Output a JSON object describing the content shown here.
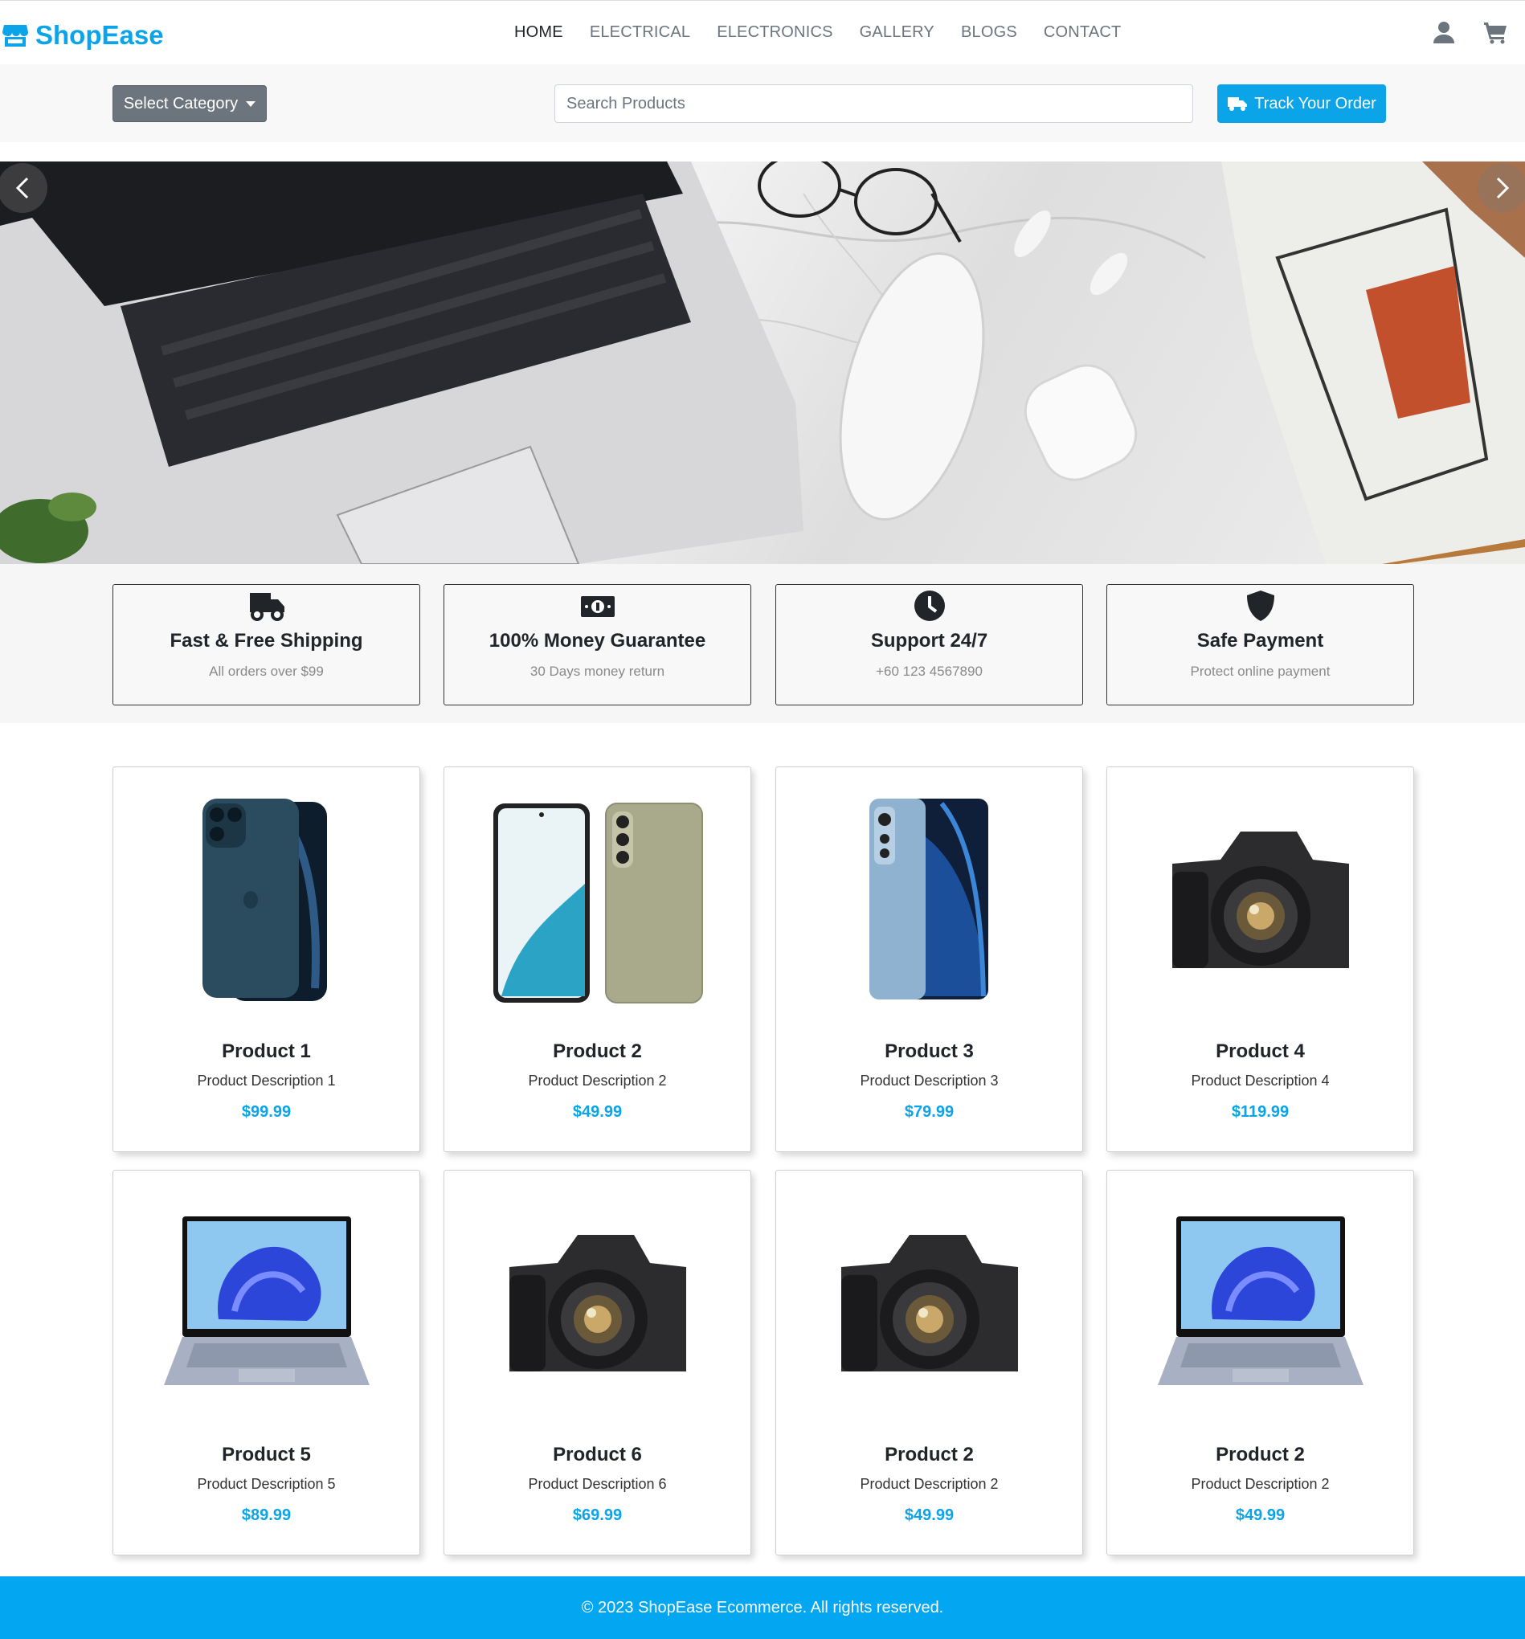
{
  "brand": {
    "name": "ShopEase",
    "color": "#0ba4e8",
    "icon": "store-icon"
  },
  "nav": {
    "links": [
      {
        "label": "HOME",
        "active": true
      },
      {
        "label": "ELECTRICAL",
        "active": false
      },
      {
        "label": "ELECTRONICS",
        "active": false
      },
      {
        "label": "GALLERY",
        "active": false
      },
      {
        "label": "BLOGS",
        "active": false
      },
      {
        "label": "CONTACT",
        "active": false
      }
    ],
    "icons": [
      "user-icon",
      "cart-icon"
    ]
  },
  "search": {
    "category_label": "Select Category",
    "placeholder": "Search Products",
    "track_label": "Track Your Order"
  },
  "hero": {
    "alt": "laptop-desk-scene"
  },
  "features": [
    {
      "icon": "truck-icon",
      "title": "Fast & Free Shipping",
      "subtitle": "All orders over $99"
    },
    {
      "icon": "money-icon",
      "title": "100% Money Guarantee",
      "subtitle": "30 Days money return"
    },
    {
      "icon": "clock-icon",
      "title": "Support 24/7",
      "subtitle": "+60 123 4567890"
    },
    {
      "icon": "shield-icon",
      "title": "Safe Payment",
      "subtitle": "Protect online payment"
    }
  ],
  "products": [
    {
      "title": "Product 1",
      "description": "Product Description 1",
      "price": "$99.99",
      "image": "iphone"
    },
    {
      "title": "Product 2",
      "description": "Product Description 2",
      "price": "$49.99",
      "image": "galaxy"
    },
    {
      "title": "Product 3",
      "description": "Product Description 3",
      "price": "$79.99",
      "image": "xiaomi"
    },
    {
      "title": "Product 4",
      "description": "Product Description 4",
      "price": "$119.99",
      "image": "camera"
    },
    {
      "title": "Product 5",
      "description": "Product Description 5",
      "price": "$89.99",
      "image": "laptop"
    },
    {
      "title": "Product 6",
      "description": "Product Description 6",
      "price": "$69.99",
      "image": "camera"
    },
    {
      "title": "Product 2",
      "description": "Product Description 2",
      "price": "$49.99",
      "image": "camera"
    },
    {
      "title": "Product 2",
      "description": "Product Description 2",
      "price": "$49.99",
      "image": "laptop"
    }
  ],
  "footer": {
    "text": "© 2023 ShopEase Ecommerce. All rights reserved."
  },
  "colors": {
    "accent": "#0ba4e8",
    "footer": "#02a6f1",
    "category_button": "#6c757d"
  }
}
